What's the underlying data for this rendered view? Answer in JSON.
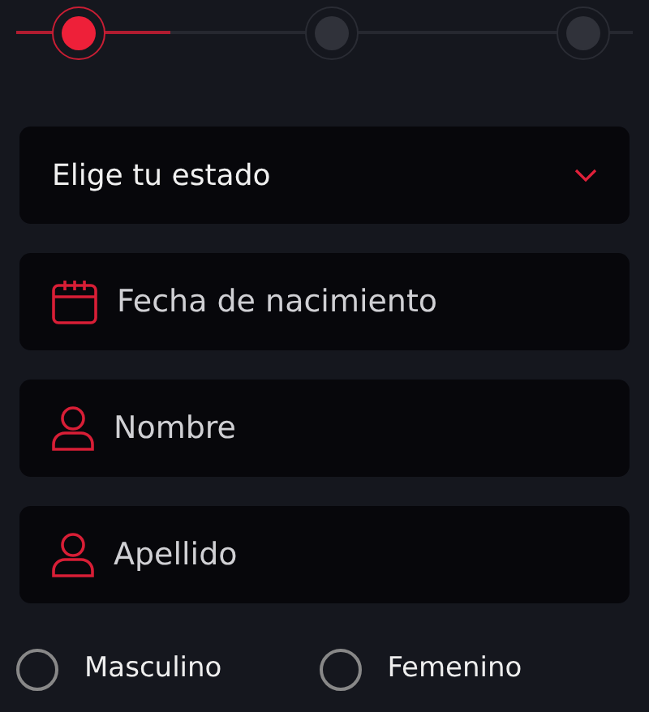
{
  "stepper": {
    "level": 0.25,
    "steps": [
      {
        "selected": true
      },
      {
        "selected": false
      },
      {
        "selected": false
      }
    ]
  },
  "fields": [
    {
      "kind": "select",
      "placeholder": "Elige tu estado"
    },
    {
      "kind": "date",
      "placeholder": "Fecha de nacimiento"
    },
    {
      "kind": "person",
      "placeholder": "Nombre"
    },
    {
      "kind": "person",
      "placeholder": "Apellido"
    }
  ],
  "gender": [
    {
      "label": "Masculino",
      "selected": false
    },
    {
      "label": "Femenino",
      "selected": false
    }
  ]
}
